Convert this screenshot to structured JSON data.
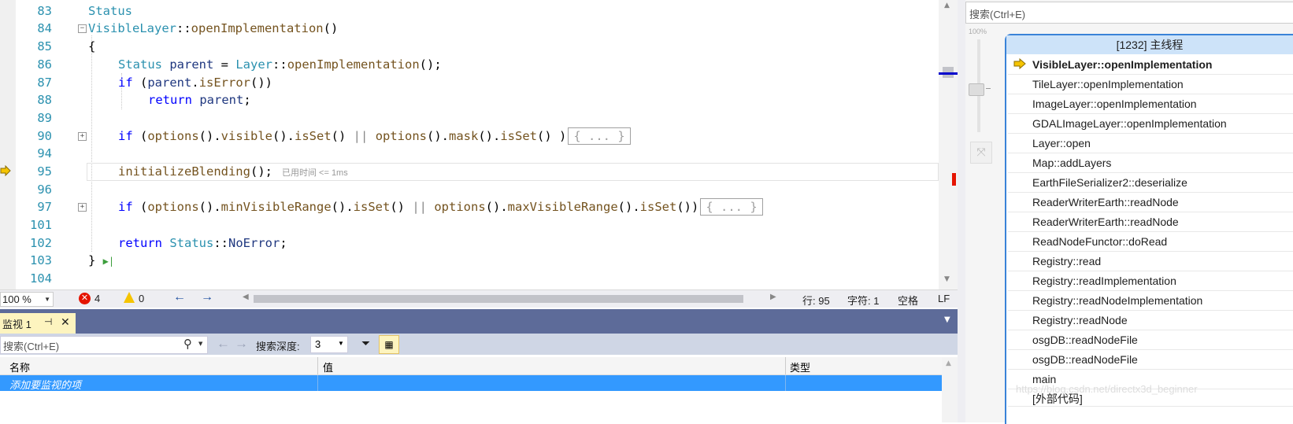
{
  "editor": {
    "lines": [
      {
        "num": "83",
        "text": "Status"
      },
      {
        "num": "84",
        "text": "VisibleLayer::openImplementation()"
      },
      {
        "num": "85",
        "text": "{"
      },
      {
        "num": "86",
        "text": "Status parent = Layer::openImplementation();"
      },
      {
        "num": "87",
        "text": "if (parent.isError())"
      },
      {
        "num": "88",
        "text": "return parent;"
      },
      {
        "num": "89",
        "text": ""
      },
      {
        "num": "90",
        "text": "if (options().visible().isSet() || options().mask().isSet() )"
      },
      {
        "num": "94",
        "text": ""
      },
      {
        "num": "95",
        "text": "initializeBlending();"
      },
      {
        "num": "96",
        "text": ""
      },
      {
        "num": "97",
        "text": "if (options().minVisibleRange().isSet() || options().maxVisibleRange().isSet())"
      },
      {
        "num": "101",
        "text": ""
      },
      {
        "num": "102",
        "text": "return Status::NoError;"
      },
      {
        "num": "103",
        "text": "}"
      },
      {
        "num": "104",
        "text": ""
      }
    ],
    "collapsed_label": "{ ... }",
    "perf_tip": "已用时间 <= 1ms"
  },
  "status_bar": {
    "zoom": "100 %",
    "errors": "4",
    "warnings": "0",
    "line": "行: 95",
    "char": "字符: 1",
    "whitespace": "空格",
    "line_ending": "LF"
  },
  "watch": {
    "tab_label": "监视 1",
    "search_placeholder": "搜索(Ctrl+E)",
    "search_depth_label": "搜索深度:",
    "search_depth_value": "3",
    "columns": [
      "名称",
      "值",
      "类型"
    ],
    "add_item_label": "添加要监视的项"
  },
  "parallel_stacks": {
    "search_placeholder": "搜索(Ctrl+E)",
    "zoom_label": "100%",
    "thread_header": "[1232] 主线程",
    "frames": [
      "VisibleLayer::openImplementation",
      "TileLayer::openImplementation",
      "ImageLayer::openImplementation",
      "GDALImageLayer::openImplementation",
      "Layer::open",
      "Map::addLayers",
      "EarthFileSerializer2::deserialize",
      "ReaderWriterEarth::readNode",
      "ReaderWriterEarth::readNode",
      "ReadNodeFunctor::doRead",
      "Registry::read",
      "Registry::readImplementation",
      "Registry::readNodeImplementation",
      "Registry::readNode",
      "osgDB::readNodeFile",
      "osgDB::readNodeFile",
      "main",
      "[外部代码]"
    ],
    "watermark": "https://blog.csdn.net/directx3d_beginner"
  },
  "colors": {
    "accent": "#3a83d8",
    "selection": "#3399ff",
    "panel_title": "#5d6b99",
    "error": "#e51400",
    "warning": "#f5c400"
  }
}
